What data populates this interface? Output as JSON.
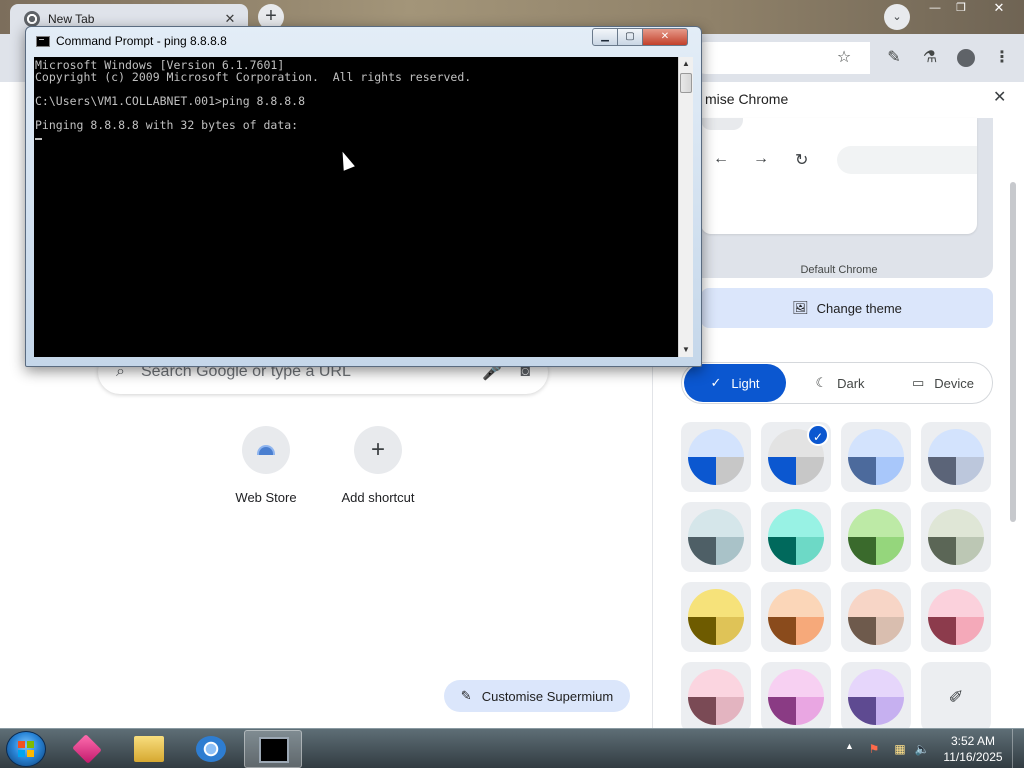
{
  "browser": {
    "tab": {
      "title": "New Tab",
      "close": "✕"
    },
    "new_tab_symbol": "+",
    "tab_search_symbol": "⌄",
    "window_controls": {
      "minimize": "—",
      "maximize": "❐",
      "close": "✕"
    },
    "toolbar_icons": [
      "star-icon",
      "pen-icon",
      "flask-icon",
      "profile-icon",
      "menu-icon"
    ],
    "toolbar_symbols": {
      "star": "☆",
      "pen": "✎",
      "flask": "⚗",
      "menu": "⋮"
    }
  },
  "ntp": {
    "search_placeholder": "Search Google or type a URL",
    "shortcuts": [
      {
        "label": "Web Store"
      },
      {
        "label": "Add shortcut",
        "symbol": "+"
      }
    ],
    "customise_button": "Customise Supermium"
  },
  "side_panel": {
    "title": "mise Chrome",
    "close": "✕",
    "theme_name": "Default Chrome",
    "change_theme_label": "Change theme",
    "mode": {
      "selected": "Light",
      "options": [
        {
          "label": "Light",
          "icon": "check-icon",
          "symbol": "✓"
        },
        {
          "label": "Dark",
          "icon": "moon-icon",
          "symbol": "☾"
        },
        {
          "label": "Device",
          "icon": "monitor-icon",
          "symbol": "▭"
        }
      ]
    },
    "swatches": [
      {
        "top": "#d3e3fd",
        "left": "#0b57d0",
        "right": "#c7c7c7",
        "selected": false
      },
      {
        "top": "#e3e3e3",
        "left": "#0b57d0",
        "right": "#c7c7c7",
        "selected": true
      },
      {
        "top": "#d3e3fd",
        "left": "#4c6a9c",
        "right": "#a8c7fa",
        "selected": false
      },
      {
        "top": "#d3e3fd",
        "left": "#5b6478",
        "right": "#bcc7dc",
        "selected": false
      },
      {
        "top": "#d5e6ea",
        "left": "#4e5f66",
        "right": "#a9c2c8",
        "selected": false
      },
      {
        "top": "#98f2e4",
        "left": "#00695c",
        "right": "#6dd9c6",
        "selected": false
      },
      {
        "top": "#bdeaa6",
        "left": "#3a6a2c",
        "right": "#95d67c",
        "selected": false
      },
      {
        "top": "#dfe6d6",
        "left": "#5b6656",
        "right": "#bcc7b4",
        "selected": false
      },
      {
        "top": "#f6e27a",
        "left": "#6e5b00",
        "right": "#dfc357",
        "selected": false
      },
      {
        "top": "#fbd6b8",
        "left": "#8a4b1c",
        "right": "#f6a97a",
        "selected": false
      },
      {
        "top": "#f7d5c6",
        "left": "#6e5a4c",
        "right": "#d9beaf",
        "selected": false
      },
      {
        "top": "#fbd1dc",
        "left": "#8c3b4c",
        "right": "#f4a9b9",
        "selected": false
      },
      {
        "top": "#fbd5e0",
        "left": "#7a4a55",
        "right": "#e3b4c0",
        "selected": false
      },
      {
        "top": "#f7d0f2",
        "left": "#8a3b84",
        "right": "#e9a6e2",
        "selected": false
      },
      {
        "top": "#e6d6fb",
        "left": "#5e4a91",
        "right": "#c6b0f0",
        "selected": false
      }
    ],
    "custom_color_symbol": "✐"
  },
  "cmd": {
    "title": "Command Prompt - ping  8.8.8.8",
    "controls": {
      "minimize": "▁",
      "maximize": "▢",
      "close": "✕"
    },
    "lines": [
      "Microsoft Windows [Version 6.1.7601]",
      "Copyright (c) 2009 Microsoft Corporation.  All rights reserved.",
      "",
      "C:\\Users\\VM1.COLLABNET.001>ping 8.8.8.8",
      "",
      "Pinging 8.8.8.8 with 32 bytes of data:"
    ],
    "scroll_up": "▲",
    "scroll_down": "▼"
  },
  "taskbar": {
    "apps": [
      {
        "name": "pink-cube-app",
        "active": false
      },
      {
        "name": "file-explorer",
        "active": false
      },
      {
        "name": "chromium-browser",
        "active": false
      },
      {
        "name": "command-prompt",
        "active": true
      }
    ],
    "tray_arrow": "▲",
    "tray_symbols": {
      "flag": "⚑",
      "network": "▦",
      "volume": "🔈"
    },
    "time": "3:52 AM",
    "date": "11/16/2025"
  }
}
